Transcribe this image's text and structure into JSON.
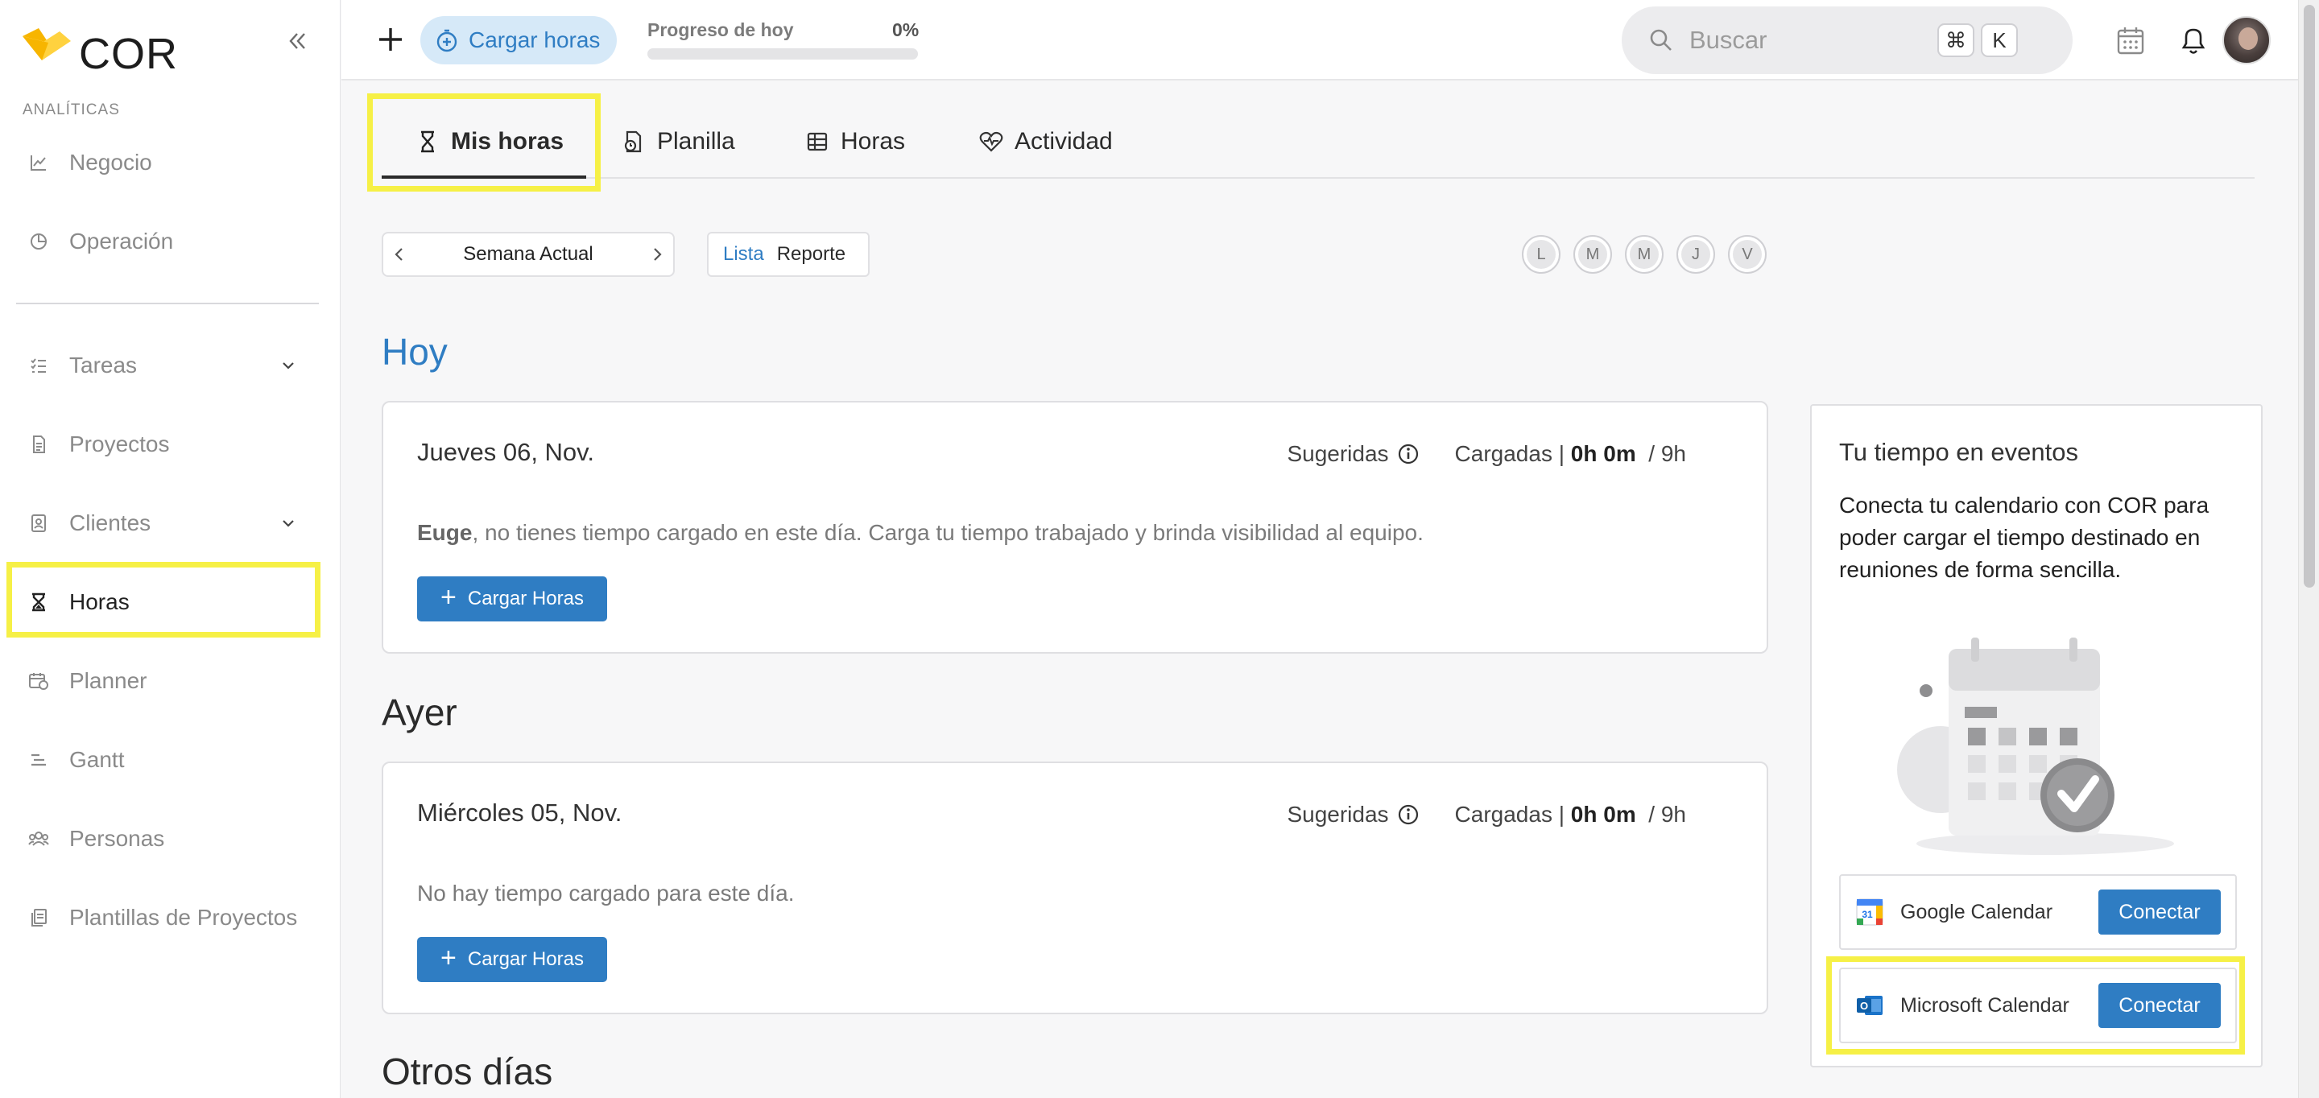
{
  "app": {
    "logo_text": "COR"
  },
  "sidebar": {
    "section_label": "ANALÍTICAS",
    "items": [
      {
        "label": "Negocio",
        "icon": "chart-line-icon"
      },
      {
        "label": "Operación",
        "icon": "pie-chart-icon"
      },
      {
        "label": "Tareas",
        "icon": "checklist-icon",
        "expandable": true
      },
      {
        "label": "Proyectos",
        "icon": "document-icon"
      },
      {
        "label": "Clientes",
        "icon": "contact-card-icon",
        "expandable": true
      },
      {
        "label": "Horas",
        "icon": "hourglass-icon",
        "active": true
      },
      {
        "label": "Planner",
        "icon": "calendar-clock-icon"
      },
      {
        "label": "Gantt",
        "icon": "gantt-icon"
      },
      {
        "label": "Personas",
        "icon": "people-icon"
      },
      {
        "label": "Plantillas de Proyectos",
        "icon": "templates-icon"
      }
    ]
  },
  "topbar": {
    "cargar_label": "Cargar horas",
    "progress_label": "Progreso de hoy",
    "progress_pct": "0%",
    "progress_value": 0,
    "search_placeholder": "Buscar",
    "kbd_cmd": "⌘",
    "kbd_k": "K"
  },
  "tabs": [
    {
      "label": "Mis horas",
      "icon": "hourglass-icon",
      "active": true
    },
    {
      "label": "Planilla",
      "icon": "timesheet-icon"
    },
    {
      "label": "Horas",
      "icon": "table-icon"
    },
    {
      "label": "Actividad",
      "icon": "heart-pulse-icon"
    }
  ],
  "controls": {
    "week_label": "Semana Actual",
    "view_list": "Lista",
    "view_report": "Reporte",
    "days": [
      "L",
      "M",
      "M",
      "J",
      "V"
    ]
  },
  "sections": {
    "today": "Hoy",
    "yesterday": "Ayer",
    "other_days": "Otros días"
  },
  "cards": {
    "today": {
      "date": "Jueves 06, Nov.",
      "suggested_label": "Sugeridas",
      "loaded_label": "Cargadas |",
      "loaded_value": "0h 0m",
      "loaded_total": "/ 9h",
      "message_name": "Euge",
      "message_rest": ", no tienes tiempo cargado en este día. Carga tu tiempo trabajado y brinda visibilidad al equipo.",
      "button": "Cargar Horas"
    },
    "yesterday": {
      "date": "Miércoles 05, Nov.",
      "suggested_label": "Sugeridas",
      "loaded_label": "Cargadas |",
      "loaded_value": "0h 0m",
      "loaded_total": "/ 9h",
      "message": "No hay tiempo cargado para este día.",
      "button": "Cargar Horas"
    }
  },
  "events_panel": {
    "title": "Tu tiempo en eventos",
    "description": "Conecta tu calendario con COR para poder cargar el tiempo destinado en reuniones de forma sencilla.",
    "integrations": [
      {
        "name": "Google Calendar",
        "icon": "google-calendar-icon",
        "button": "Conectar"
      },
      {
        "name": "Microsoft Calendar",
        "icon": "outlook-icon",
        "button": "Conectar"
      }
    ]
  },
  "colors": {
    "accent": "#2f7dc3",
    "highlight": "#f6f046"
  }
}
